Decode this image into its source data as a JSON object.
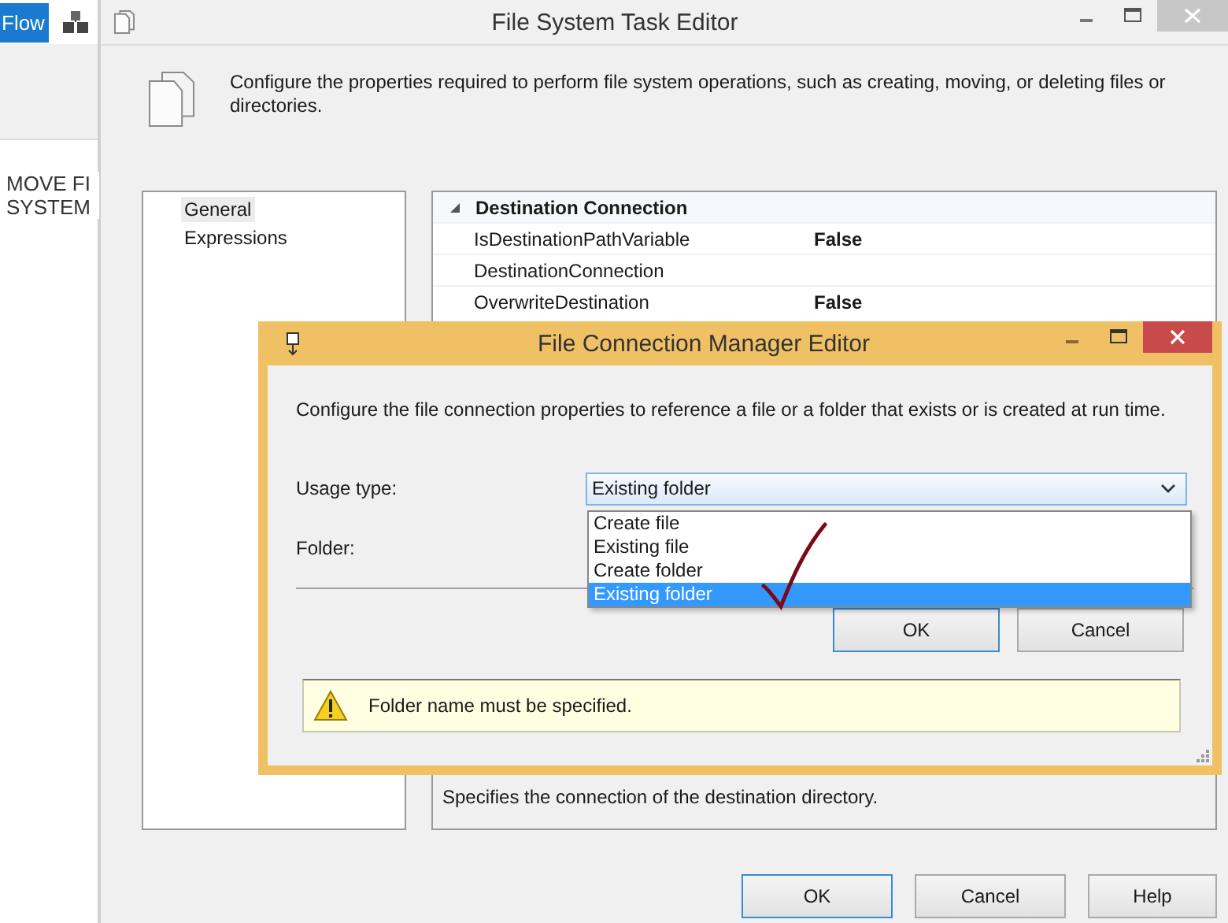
{
  "background_app": {
    "tab": "Flow",
    "task_label_lines": [
      "MOVE FI",
      "SYSTEM"
    ]
  },
  "window": {
    "title": "File System Task Editor",
    "description": "Configure the properties required to perform file system operations, such as creating, moving, or deleting files or directories.",
    "nav_items": [
      {
        "label": "General",
        "selected": true
      },
      {
        "label": "Expressions",
        "selected": false
      }
    ],
    "property_grid": {
      "category": "Destination Connection",
      "expanded": true,
      "rows": [
        {
          "name": "IsDestinationPathVariable",
          "value": "False"
        },
        {
          "name": "DestinationConnection"
        },
        {
          "name": "OverwriteDestination",
          "value": "False"
        }
      ],
      "help_text": "Specifies the connection of the destination directory."
    },
    "buttons": [
      "OK",
      "Cancel",
      "Help"
    ]
  },
  "dialog": {
    "title": "File Connection Manager Editor",
    "description": "Configure the file connection properties to reference a file or a folder that exists or is created at run time.",
    "usage_label": "Usage type:",
    "usage_value": "Existing folder",
    "usage_options": [
      {
        "label": "Create file",
        "selected": false
      },
      {
        "label": "Existing file",
        "selected": false
      },
      {
        "label": "Create folder",
        "selected": false
      },
      {
        "label": "Existing folder",
        "selected": true
      }
    ],
    "folder_label": "Folder:",
    "buttons": [
      "OK",
      "Cancel"
    ],
    "warning": "Folder name must be specified."
  }
}
